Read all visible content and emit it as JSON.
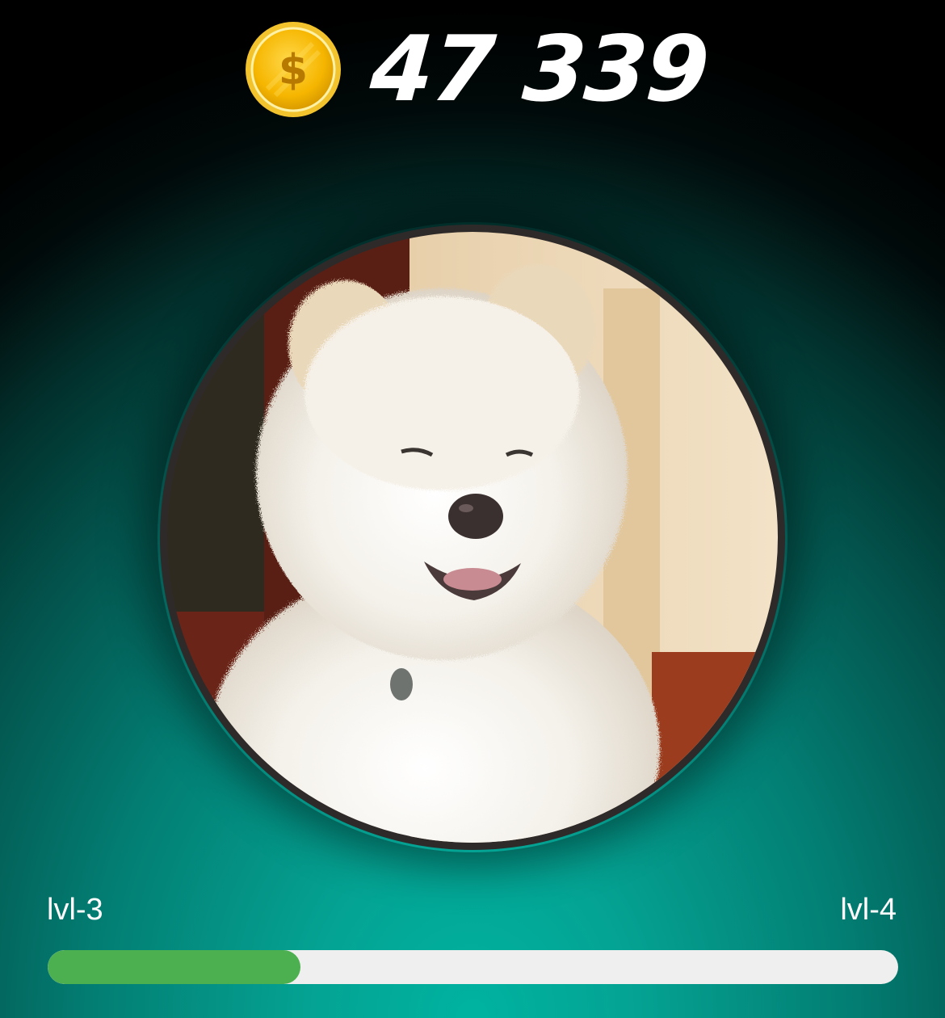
{
  "balance": {
    "coin_icon": "dollar-coin-icon",
    "amount": "47 339"
  },
  "avatar": {
    "subject": "white-fluffy-dog-photo"
  },
  "level": {
    "current_label": "lvl-3",
    "next_label": "lvl-4",
    "progress_fraction": 0.297
  },
  "colors": {
    "coin_gold": "#f5b400",
    "progress_fill": "#4caf50",
    "progress_track": "#efefef",
    "background_teal": "#00b3a1",
    "background_top": "#000000"
  }
}
